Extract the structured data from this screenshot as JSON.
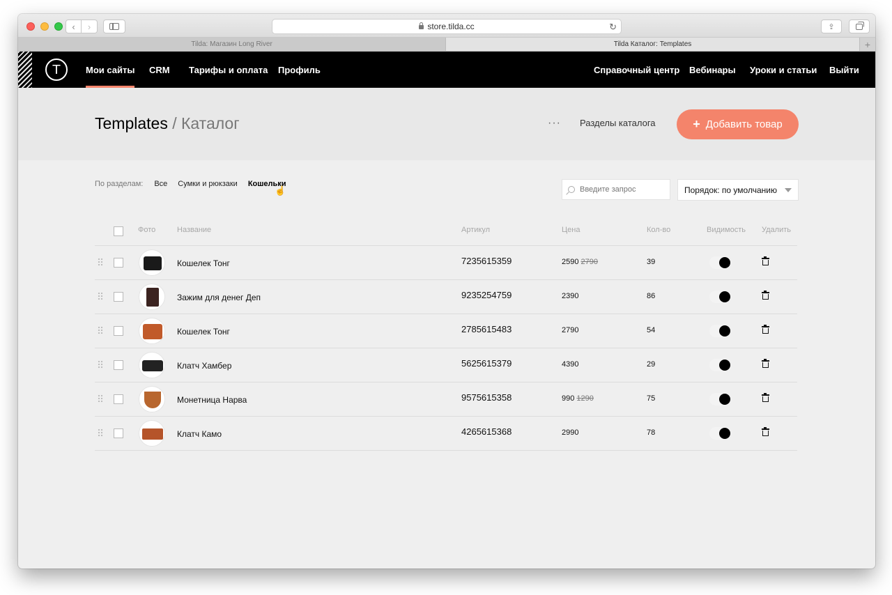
{
  "browser": {
    "url": "store.tilda.cc",
    "tabs": [
      "Tilda: Магазин Long River",
      "Tilda Каталог: Templates"
    ]
  },
  "nav": {
    "left": [
      "Мои сайты",
      "CRM",
      "Тарифы и оплата",
      "Профиль"
    ],
    "right": [
      "Справочный центр",
      "Вебинары",
      "Уроки и статьи",
      "Выйти"
    ],
    "logo": "Т",
    "active": "Мои сайты",
    "accent_color": "#f4846b"
  },
  "header": {
    "title": "Templates",
    "separator": "/",
    "subtitle": "Каталог",
    "more": "···",
    "sections_link": "Разделы каталога",
    "add_plus": "+",
    "add_button": "Добавить товар"
  },
  "filters": {
    "label": "По разделам:",
    "items": [
      "Все",
      "Сумки и рюкзаки",
      "Кошельки"
    ],
    "active": "Кошельки"
  },
  "search": {
    "placeholder": "Введите запрос"
  },
  "sort": {
    "value": "Порядок: по умолчанию"
  },
  "table": {
    "columns": [
      "Фото",
      "Название",
      "Артикул",
      "Цена",
      "Кол-во",
      "Видимость",
      "Удалить"
    ],
    "rows": [
      {
        "name": "Кошелек Тонг",
        "sku": "7235615359",
        "price": "2590",
        "old_price": "2790",
        "qty": "39",
        "visible": true,
        "thumb_color": "#1a1a1a"
      },
      {
        "name": "Зажим для денег Деп",
        "sku": "9235254759",
        "price": "2390",
        "old_price": "",
        "qty": "86",
        "visible": true,
        "thumb_color": "#3b2320"
      },
      {
        "name": "Кошелек Тонг",
        "sku": "2785615483",
        "price": "2790",
        "old_price": "",
        "qty": "54",
        "visible": true,
        "thumb_color": "#c15a2a"
      },
      {
        "name": "Клатч Хамбер",
        "sku": "5625615379",
        "price": "4390",
        "old_price": "",
        "qty": "29",
        "visible": true,
        "thumb_color": "#222222"
      },
      {
        "name": "Монетница Нарва",
        "sku": "9575615358",
        "price": "990",
        "old_price": "1290",
        "qty": "75",
        "visible": true,
        "thumb_color": "#b8662e"
      },
      {
        "name": "Клатч Камо",
        "sku": "4265615368",
        "price": "2990",
        "old_price": "",
        "qty": "78",
        "visible": true,
        "thumb_color": "#b5542a"
      }
    ]
  }
}
